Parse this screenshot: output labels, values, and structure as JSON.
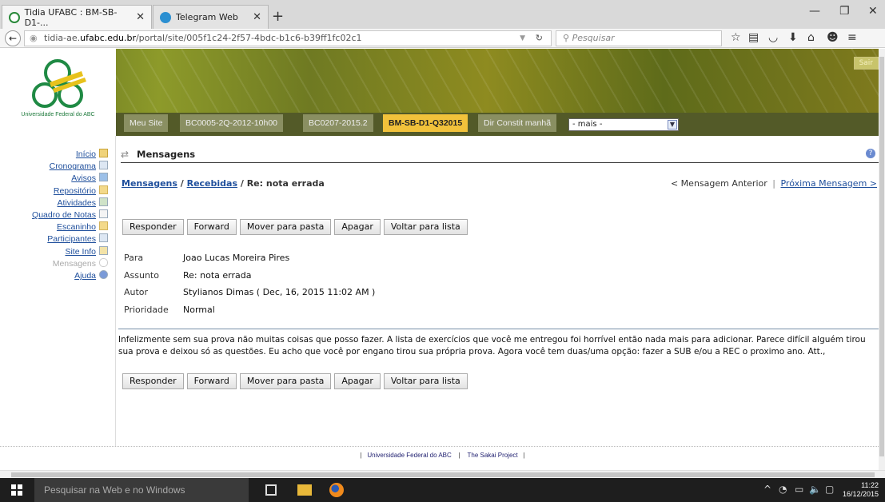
{
  "browser": {
    "tabs": [
      {
        "label": "Tidia UFABC : BM-SB-D1-...",
        "active": true
      },
      {
        "label": "Telegram Web",
        "active": false
      }
    ],
    "url_prefix": "tidia-ae.",
    "url_domain": "ufabc.edu.br",
    "url_path": "/portal/site/005f1c24-2f57-4bdc-b1c6-b39ff1fc02c1",
    "search_placeholder": "Pesquisar"
  },
  "site": {
    "logo_caption": "Universidade Federal do ABC",
    "logout_label": "Sair",
    "tabs": [
      "Meu Site",
      "BC0005-2Q-2012-10h00",
      "BC0207-2015.2",
      "BM-SB-D1-Q32015",
      "Dir Constit manhã"
    ],
    "selected_tab": "BM-SB-D1-Q32015",
    "more_select": "- mais -"
  },
  "tool_menu": [
    {
      "label": "Início",
      "icon": "home-icon"
    },
    {
      "label": "Cronograma",
      "icon": "calendar-icon"
    },
    {
      "label": "Avisos",
      "icon": "megaphone-icon"
    },
    {
      "label": "Repositório",
      "icon": "folder-icon"
    },
    {
      "label": "Atividades",
      "icon": "assignment-icon"
    },
    {
      "label": "Quadro de Notas",
      "icon": "gradebook-icon"
    },
    {
      "label": "Escaninho",
      "icon": "dropbox-icon"
    },
    {
      "label": "Participantes",
      "icon": "people-icon"
    },
    {
      "label": "Site Info",
      "icon": "info-icon"
    },
    {
      "label": "Mensagens",
      "icon": "message-icon",
      "current": true
    },
    {
      "label": "Ajuda",
      "icon": "help-icon"
    }
  ],
  "page": {
    "title": "Mensagens",
    "breadcrumb": {
      "root": "Mensagens",
      "folder": "Recebidas",
      "separator": " / ",
      "current": "Re: nota errada"
    },
    "prev_message": "< Mensagem Anterior",
    "nav_separator": "|",
    "next_message": "Próxima Mensagem >",
    "buttons": [
      "Responder",
      "Forward",
      "Mover para pasta",
      "Apagar",
      "Voltar para lista"
    ],
    "meta": [
      {
        "key": "Para",
        "value": "Joao Lucas Moreira Pires"
      },
      {
        "key": "Assunto",
        "value": "Re: nota errada"
      },
      {
        "key": "Autor",
        "value": "Stylianos Dimas ( Dec, 16, 2015 11:02 AM )"
      },
      {
        "key": "Prioridade",
        "value": "Normal"
      }
    ],
    "body": "Infelizmente sem sua prova não muitas coisas que posso fazer. A lista de exercícios que você me entregou foi horrível então nada mais para adicionar. Parece difícil alguém tirou sua prova e deixou só as questões. Eu acho que você por engano tirou sua própria prova. Agora você tem duas/uma opção: fazer a SUB e/ou a REC o proximo ano. Att.,"
  },
  "footer": {
    "sep": "|",
    "link1": "Universidade Federal do ABC",
    "link2": "The Sakai Project"
  },
  "taskbar": {
    "search_placeholder": "Pesquisar na Web e no Windows",
    "time": "11:22",
    "date": "16/12/2015"
  }
}
